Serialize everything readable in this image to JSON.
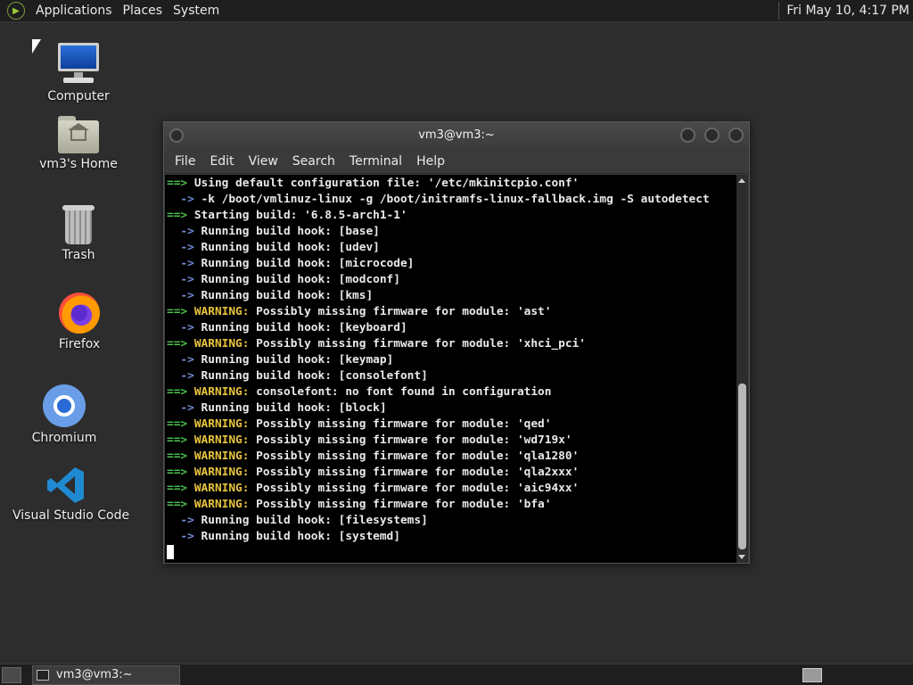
{
  "top_panel": {
    "menus": [
      "Applications",
      "Places",
      "System"
    ],
    "clock": "Fri May 10,  4:17 PM"
  },
  "desktop_icons": [
    {
      "label": "Computer",
      "icon": "computer-icon"
    },
    {
      "label": "vm3's Home",
      "icon": "home-folder-icon"
    },
    {
      "label": "Trash",
      "icon": "trash-icon"
    },
    {
      "label": "Firefox",
      "icon": "firefox-icon"
    },
    {
      "label": "Chromium",
      "icon": "chromium-icon"
    },
    {
      "label": "Visual Studio Code",
      "icon": "vscode-icon"
    }
  ],
  "terminal": {
    "title": "vm3@vm3:~",
    "menu": [
      "File",
      "Edit",
      "View",
      "Search",
      "Terminal",
      "Help"
    ],
    "lines": [
      {
        "prefix": "==>",
        "prefix_color": "green",
        "text": " Using default configuration file: '/etc/mkinitcpio.conf'",
        "text_color": "white"
      },
      {
        "prefix": "  ->",
        "prefix_color": "blue",
        "text": " -k /boot/vmlinuz-linux -g /boot/initramfs-linux-fallback.img -S autodetect",
        "text_color": "white"
      },
      {
        "prefix": "==>",
        "prefix_color": "green",
        "text": " Starting build: '6.8.5-arch1-1'",
        "text_color": "white"
      },
      {
        "prefix": "  ->",
        "prefix_color": "blue",
        "text": " Running build hook: [base]",
        "text_color": "white"
      },
      {
        "prefix": "  ->",
        "prefix_color": "blue",
        "text": " Running build hook: [udev]",
        "text_color": "white"
      },
      {
        "prefix": "  ->",
        "prefix_color": "blue",
        "text": " Running build hook: [microcode]",
        "text_color": "white"
      },
      {
        "prefix": "  ->",
        "prefix_color": "blue",
        "text": " Running build hook: [modconf]",
        "text_color": "white"
      },
      {
        "prefix": "  ->",
        "prefix_color": "blue",
        "text": " Running build hook: [kms]",
        "text_color": "white"
      },
      {
        "prefix": "==>",
        "prefix_color": "green",
        "warn": " WARNING:",
        "text": " Possibly missing firmware for module: 'ast'",
        "text_color": "white"
      },
      {
        "prefix": "  ->",
        "prefix_color": "blue",
        "text": " Running build hook: [keyboard]",
        "text_color": "white"
      },
      {
        "prefix": "==>",
        "prefix_color": "green",
        "warn": " WARNING:",
        "text": " Possibly missing firmware for module: 'xhci_pci'",
        "text_color": "white"
      },
      {
        "prefix": "  ->",
        "prefix_color": "blue",
        "text": " Running build hook: [keymap]",
        "text_color": "white"
      },
      {
        "prefix": "  ->",
        "prefix_color": "blue",
        "text": " Running build hook: [consolefont]",
        "text_color": "white"
      },
      {
        "prefix": "==>",
        "prefix_color": "green",
        "warn": " WARNING:",
        "text": " consolefont: no font found in configuration",
        "text_color": "white"
      },
      {
        "prefix": "  ->",
        "prefix_color": "blue",
        "text": " Running build hook: [block]",
        "text_color": "white"
      },
      {
        "prefix": "==>",
        "prefix_color": "green",
        "warn": " WARNING:",
        "text": " Possibly missing firmware for module: 'qed'",
        "text_color": "white"
      },
      {
        "prefix": "==>",
        "prefix_color": "green",
        "warn": " WARNING:",
        "text": " Possibly missing firmware for module: 'wd719x'",
        "text_color": "white"
      },
      {
        "prefix": "==>",
        "prefix_color": "green",
        "warn": " WARNING:",
        "text": " Possibly missing firmware for module: 'qla1280'",
        "text_color": "white"
      },
      {
        "prefix": "==>",
        "prefix_color": "green",
        "warn": " WARNING:",
        "text": " Possibly missing firmware for module: 'qla2xxx'",
        "text_color": "white"
      },
      {
        "prefix": "==>",
        "prefix_color": "green",
        "warn": " WARNING:",
        "text": " Possibly missing firmware for module: 'aic94xx'",
        "text_color": "white"
      },
      {
        "prefix": "==>",
        "prefix_color": "green",
        "warn": " WARNING:",
        "text": " Possibly missing firmware for module: 'bfa'",
        "text_color": "white"
      },
      {
        "prefix": "  ->",
        "prefix_color": "blue",
        "text": " Running build hook: [filesystems]",
        "text_color": "white"
      },
      {
        "prefix": "  ->",
        "prefix_color": "blue",
        "text": " Running build hook: [systemd]",
        "text_color": "white"
      }
    ]
  },
  "taskbar": {
    "task_label": "vm3@vm3:~"
  },
  "colors": {
    "green": "#4ec24e",
    "blue": "#6f8fd8",
    "yellow": "#e8c43e",
    "desktop_bg": "#2d2d2d"
  }
}
